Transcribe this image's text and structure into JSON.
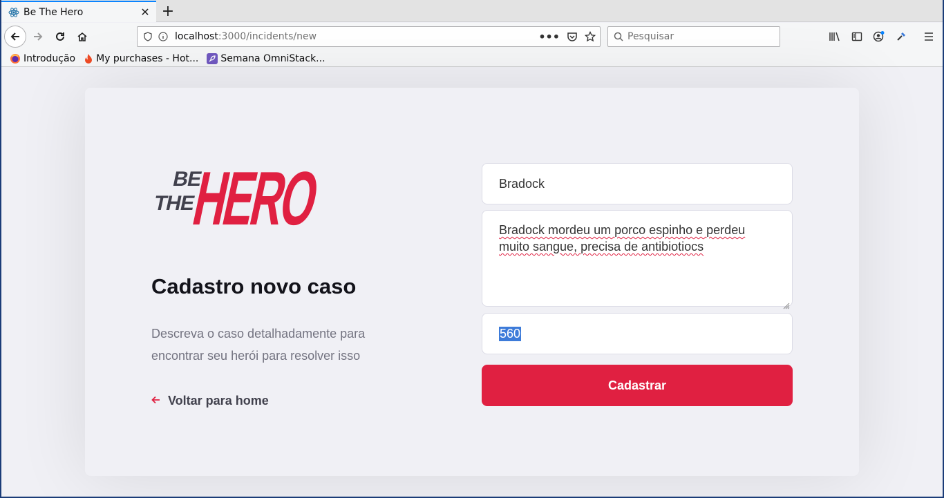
{
  "browser": {
    "tab": {
      "title": "Be The Hero",
      "favicon": "react-icon"
    },
    "url": {
      "host": "localhost",
      "path": ":3000/incidents/new"
    },
    "search": {
      "placeholder": "Pesquisar"
    },
    "bookmarks": [
      {
        "label": "Introdução",
        "icon": "firefox-icon"
      },
      {
        "label": "My purchases - Hot...",
        "icon": "flame-icon"
      },
      {
        "label": "Semana OmniStack...",
        "icon": "rocket-icon"
      }
    ]
  },
  "page": {
    "logo": {
      "top_word_1": "BE",
      "top_word_2": "THE",
      "main_word": "HERO"
    },
    "heading": "Cadastro novo caso",
    "description": "Descreva o caso detalhadamente para encontrar seu herói para resolver isso",
    "back_link": "Voltar para home",
    "form": {
      "title_value": "Bradock",
      "description_value": "Bradock mordeu um porco espinho e perdeu muito sangue, precisa de antibiotiocs",
      "value_value": "560",
      "submit_label": "Cadastrar"
    }
  },
  "colors": {
    "accent": "#e02041",
    "page_background": "#f0f0f5",
    "text_dark": "#13131a",
    "text_muted": "#737380"
  }
}
